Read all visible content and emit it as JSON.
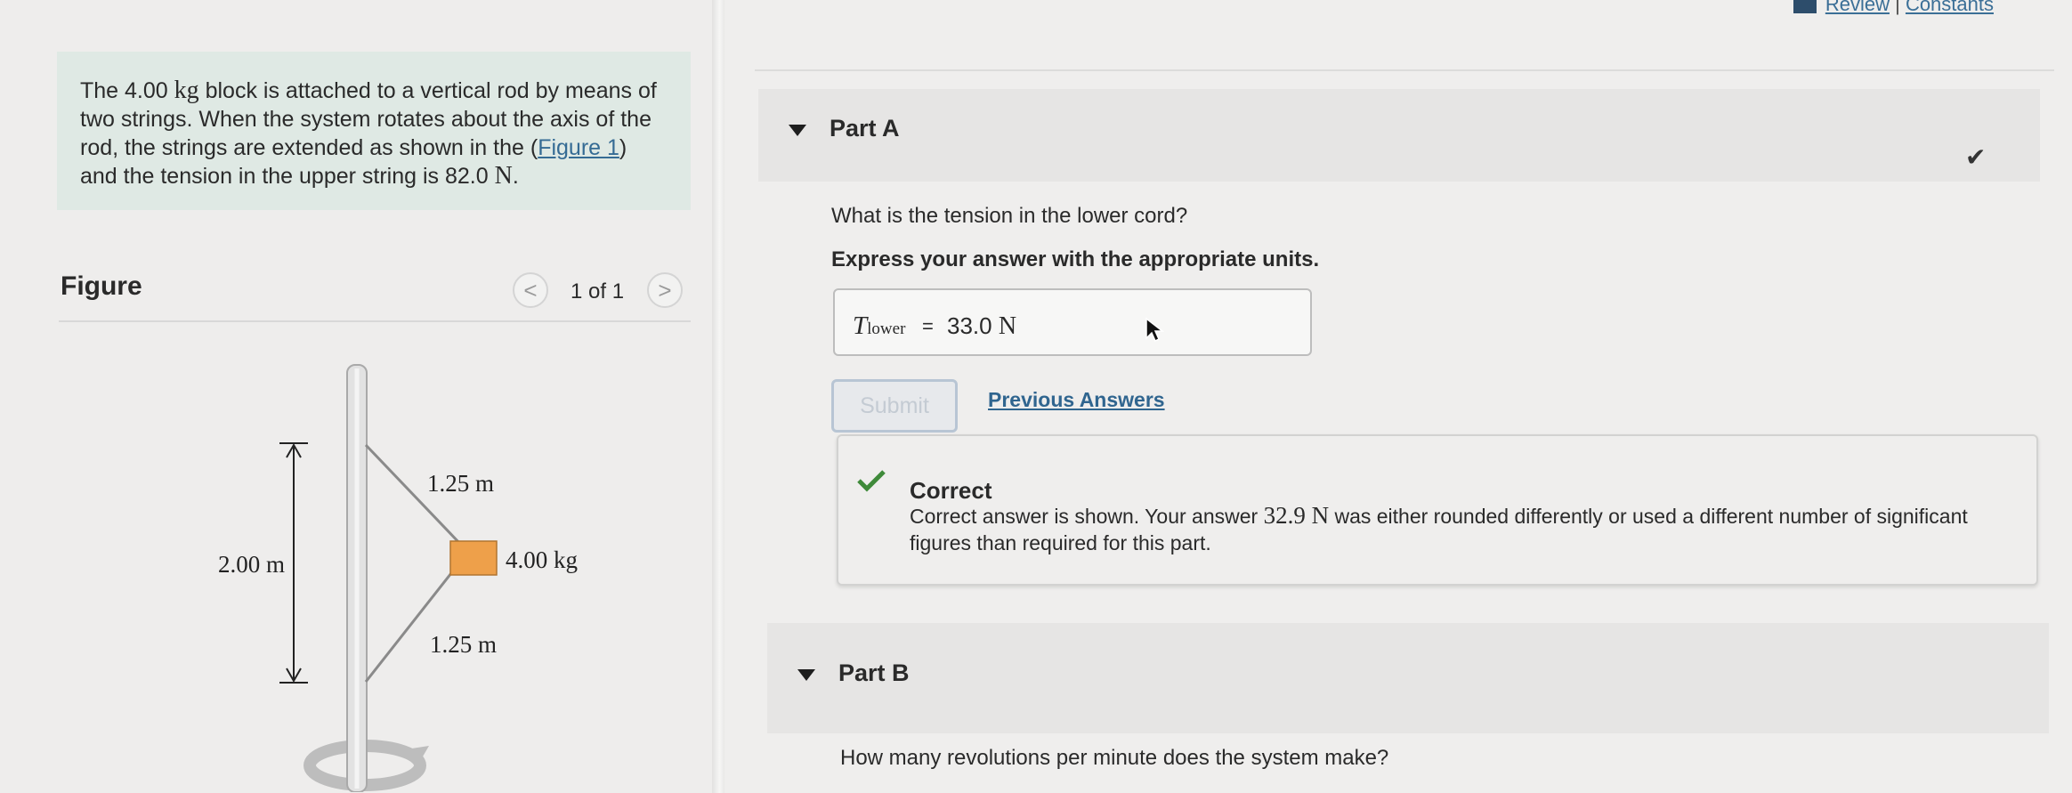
{
  "problem": {
    "text_before_mass": "The ",
    "mass": "4.00",
    "mass_unit": "kg",
    "text_after_mass": " block is attached to a vertical rod by means of two strings. When the system rotates about the axis of the rod, the strings are extended as shown in the (",
    "figure_link": "Figure 1",
    "text_after_link": ") and the tension in the upper string is ",
    "tension": "82.0",
    "tension_unit": "N",
    "end": "."
  },
  "figure": {
    "title": "Figure",
    "pager": "1 of 1",
    "prev_glyph": "<",
    "next_glyph": ">",
    "labels": {
      "upper_string": "1.25 m",
      "lower_string": "1.25 m",
      "height": "2.00 m",
      "mass": "4.00 kg"
    },
    "colors": {
      "block": "#eea04a",
      "rod": "#e2e2e2"
    }
  },
  "header_links": {
    "review": "Review",
    "separator": "|",
    "constants": "Constants"
  },
  "partA": {
    "label": "Part A",
    "question": "What is the tension in the lower cord?",
    "instruction": "Express your answer with the appropriate units.",
    "answer": {
      "variable": "T",
      "subscript": "lower",
      "equals": "=",
      "value": "33.0",
      "unit": "N"
    },
    "submit_label": "Submit",
    "previous_answers": "Previous Answers",
    "feedback": {
      "title": "Correct",
      "msg_before": "Correct answer is shown. Your answer ",
      "your_answer": "32.9 N",
      "msg_after": " was either rounded differently or used a different number of significant figures than required for this part."
    }
  },
  "partB": {
    "label": "Part B",
    "question": "How many revolutions per minute does the system make?"
  }
}
